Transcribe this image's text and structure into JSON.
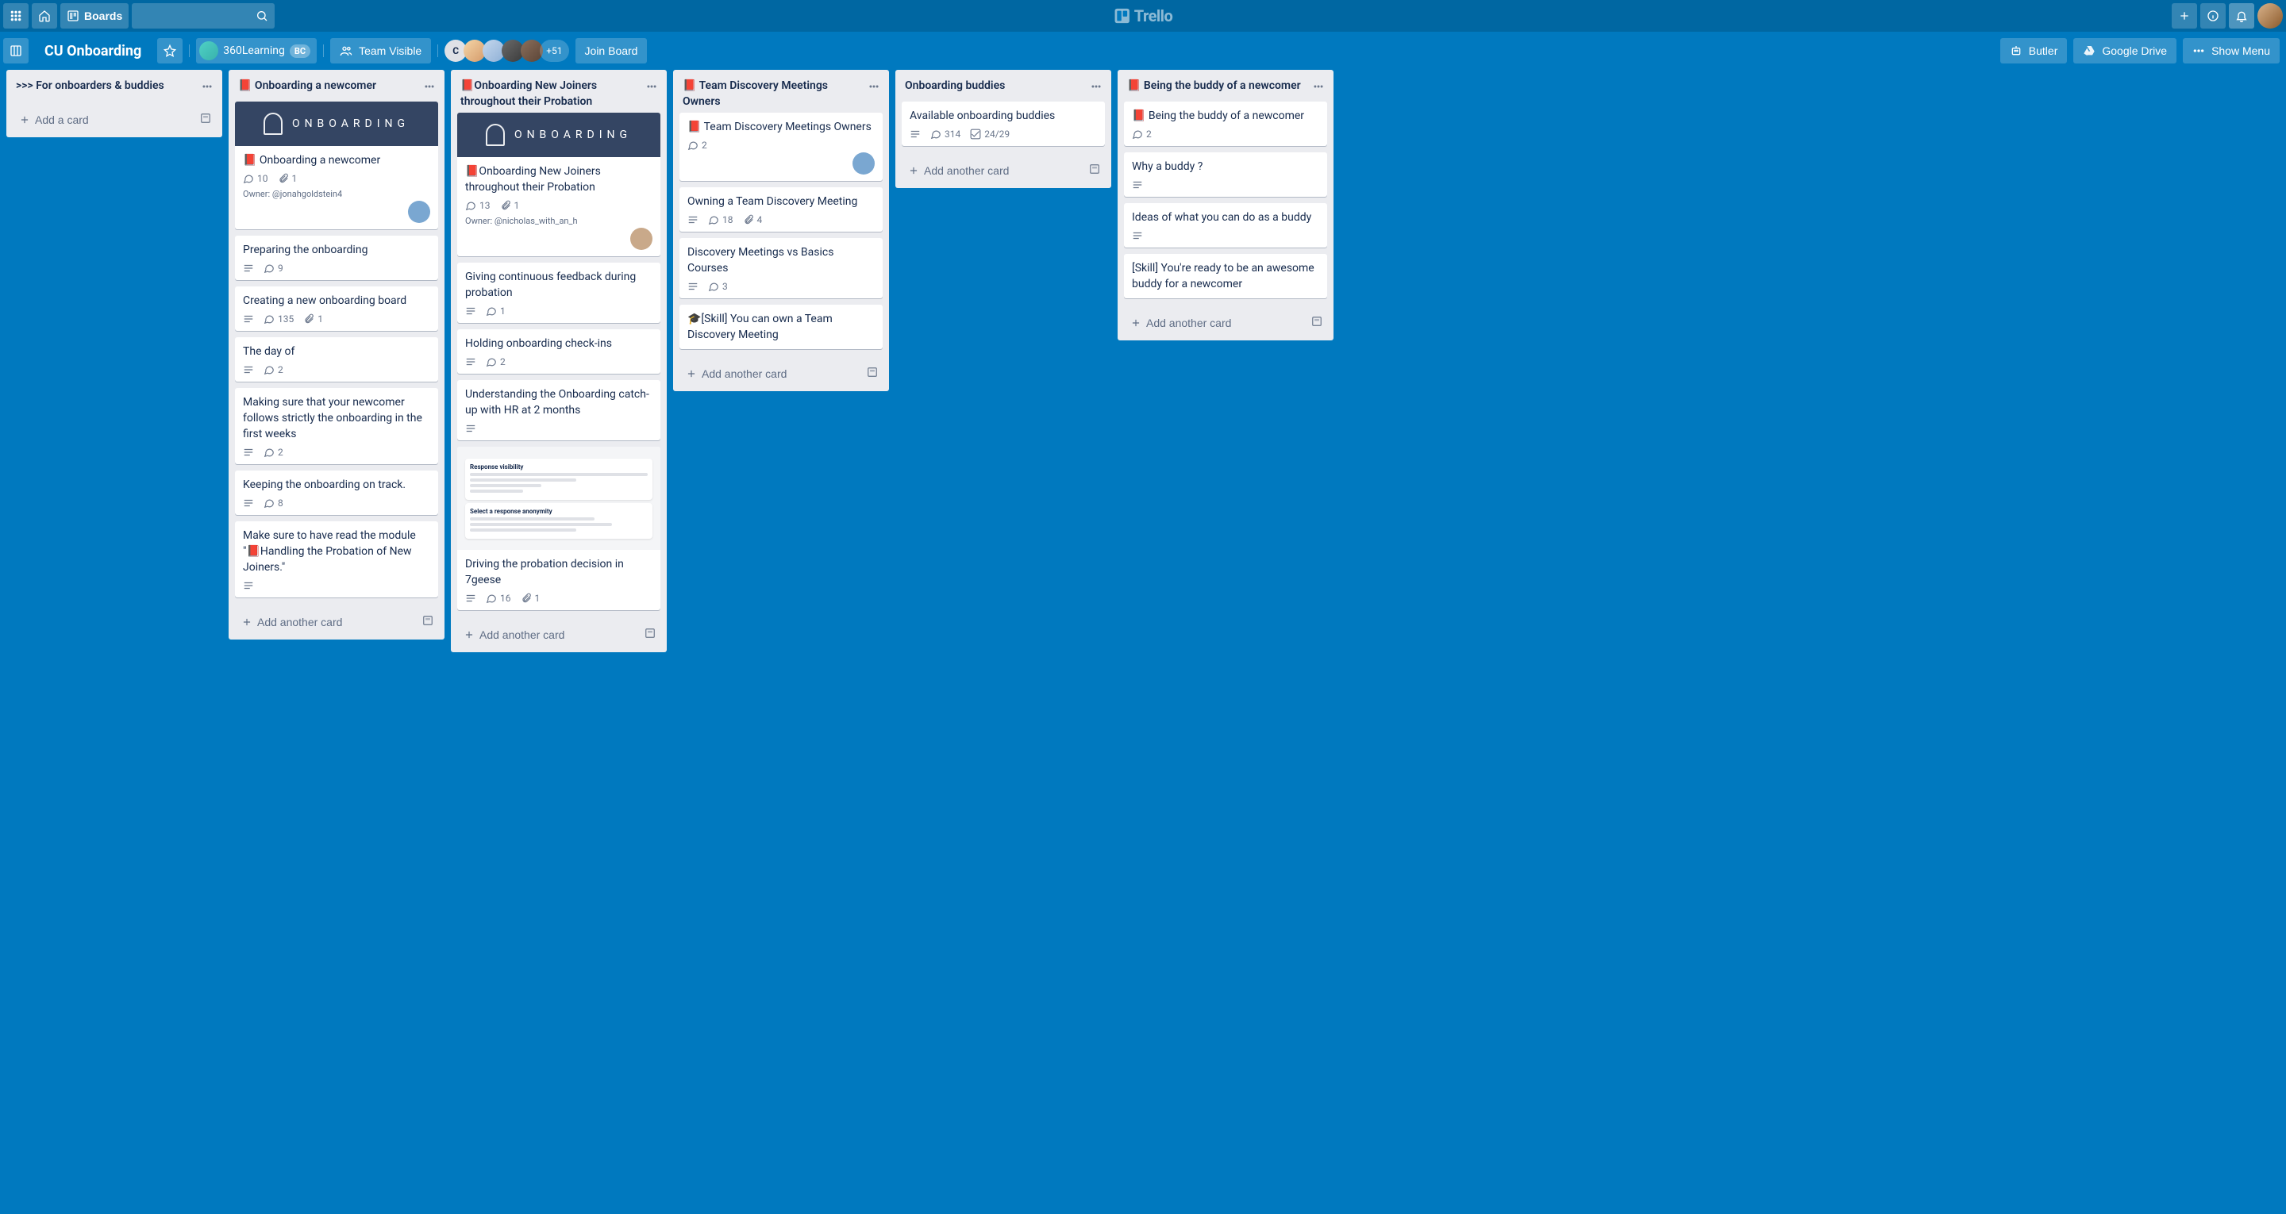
{
  "nav": {
    "boards": "Boards",
    "logo": "Trello"
  },
  "board_header": {
    "title": "CU Onboarding",
    "team": "360Learning",
    "team_badge": "BC",
    "visibility": "Team Visible",
    "first_member_initial": "C",
    "more_members": "+51",
    "join": "Join Board",
    "butler": "Butler",
    "gdrive": "Google Drive",
    "show_menu": "Show Menu"
  },
  "lists": [
    {
      "title": ">>> For onboarders & buddies",
      "add_label": "Add a card",
      "cards": []
    },
    {
      "title": "📕 Onboarding a newcomer",
      "add_label": "Add another card",
      "cards": [
        {
          "cover": "text",
          "cover_text": "ONBOARDING",
          "title": "📕 Onboarding a newcomer",
          "comments": "10",
          "attachments": "1",
          "owner": "Owner: @jonahgoldstein4",
          "member_color": "#7aa7d1"
        },
        {
          "title": "Preparing the onboarding",
          "desc": true,
          "comments": "9"
        },
        {
          "title": "Creating a new onboarding board",
          "desc": true,
          "comments": "135",
          "attachments": "1"
        },
        {
          "title": "The day of",
          "desc": true,
          "comments": "2"
        },
        {
          "title": "Making sure that your newcomer follows strictly the onboarding in the first weeks",
          "desc": true,
          "comments": "2"
        },
        {
          "title": "Keeping the onboarding on track.",
          "desc": true,
          "comments": "8"
        },
        {
          "title": "Make sure to have read the module \"📕Handling the Probation of New Joiners.\"",
          "desc": true
        }
      ]
    },
    {
      "title": "📕Onboarding New Joiners throughout their Probation",
      "add_label": "Add another card",
      "cards": [
        {
          "cover": "text",
          "cover_text": "ONBOARDING",
          "title": "📕Onboarding New Joiners throughout their Probation",
          "comments": "13",
          "attachments": "1",
          "owner": "Owner: @nicholas_with_an_h",
          "member_color": "#c9a98a"
        },
        {
          "title": "Giving continuous feedback during probation",
          "desc": true,
          "comments": "1"
        },
        {
          "title": "Holding onboarding check-ins",
          "desc": true,
          "comments": "2"
        },
        {
          "title": "Understanding the Onboarding catch-up with HR at 2 months",
          "desc": true
        },
        {
          "cover": "image",
          "title": "Driving the probation decision in 7geese",
          "desc": true,
          "comments": "16",
          "attachments": "1"
        }
      ]
    },
    {
      "title": "📕 Team Discovery Meetings Owners",
      "add_label": "Add another card",
      "cards": [
        {
          "title": "📕 Team Discovery Meetings Owners",
          "comments": "2",
          "member_color": "#7aa7d1"
        },
        {
          "title": "Owning a Team Discovery Meeting",
          "desc": true,
          "comments": "18",
          "attachments": "4"
        },
        {
          "title": "Discovery Meetings vs Basics Courses",
          "desc": true,
          "comments": "3"
        },
        {
          "title": "🎓[Skill] You can own a Team Discovery Meeting"
        }
      ]
    },
    {
      "title": "Onboarding buddies",
      "add_label": "Add another card",
      "cards": [
        {
          "title": "Available onboarding buddies",
          "desc": true,
          "comments": "314",
          "checklist": "24/29"
        }
      ]
    },
    {
      "title": "📕 Being the buddy of a newcomer",
      "add_label": "Add another card",
      "cards": [
        {
          "title": "📕 Being the buddy of a newcomer",
          "comments": "2"
        },
        {
          "title": "Why a buddy ?",
          "desc": true
        },
        {
          "title": "Ideas of what you can do as a buddy",
          "desc": true
        },
        {
          "title": "[Skill] You're ready to be an awesome buddy for a newcomer"
        }
      ]
    }
  ]
}
